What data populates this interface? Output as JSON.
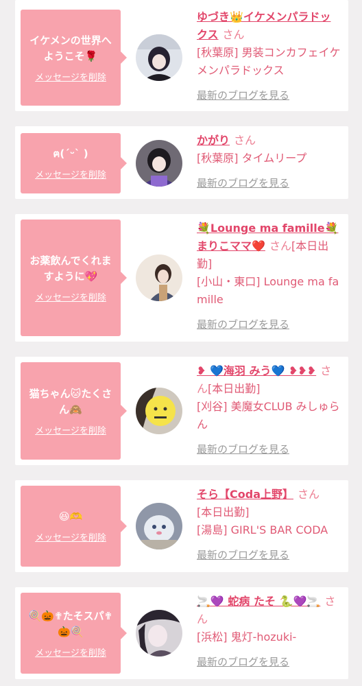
{
  "cards": [
    {
      "message": "イケメンの世界へようこそ🌹",
      "delete_label": "メッセージを削除",
      "name": "ゆづき👑イケメンパラドックス",
      "honorific": "さん",
      "status": "",
      "shop": "[秋葉原] 男装コンカフェイケメンパラドックス",
      "blog_label": "最新のブログを見る",
      "avatar_icon": "avatar-photo-icon"
    },
    {
      "message": "ฅ(ˊᵕˋ )",
      "delete_label": "メッセージを削除",
      "name": "かがり",
      "honorific": "さん",
      "status": "",
      "shop": "[秋葉原] タイムリープ",
      "blog_label": "最新のブログを見る",
      "avatar_icon": "avatar-photo-icon"
    },
    {
      "message": "お薬飲んでくれますように💖",
      "delete_label": "メッセージを削除",
      "name": "💐Lounge ma famille💐まりこママ❤️",
      "honorific": "さん",
      "status": "[本日出勤]",
      "shop": "[小山・東口] Lounge ma famille",
      "blog_label": "最新のブログを見る",
      "avatar_icon": "avatar-photo-icon"
    },
    {
      "message": "猫ちゃん🐱たくさん🙈",
      "delete_label": "メッセージを削除",
      "name": "❥ 💙海羽 みう💙 ❥❥❥",
      "honorific": "さん",
      "status": "[本日出勤]",
      "shop": "[刈谷] 美魔女CLUB みしゅらん",
      "blog_label": "最新のブログを見る",
      "avatar_icon": "avatar-photo-icon"
    },
    {
      "message": "😆🫶",
      "delete_label": "メッセージを削除",
      "name": "そら【Coda上野】",
      "honorific": "さん",
      "status": "[本日出勤]",
      "shop": "[湯島] GIRL'S BAR CODA",
      "blog_label": "最新のブログを見る",
      "avatar_icon": "avatar-photo-icon"
    },
    {
      "message": "🍭🎃✟たそスパ✟🎃🍭",
      "delete_label": "メッセージを削除",
      "name": "🚬💜 蛇病 たそ 🐍💜🚬",
      "honorific": "さん",
      "status": "",
      "shop": "[浜松] 鬼灯-hozuki-",
      "blog_label": "最新のブログを見る",
      "avatar_icon": "avatar-photo-icon"
    }
  ],
  "colors": {
    "bubble": "#f8a3ad",
    "name": "#e2466a",
    "text": "#e05a75",
    "link_gray": "#9a9a9a",
    "background": "#f1eff0"
  }
}
